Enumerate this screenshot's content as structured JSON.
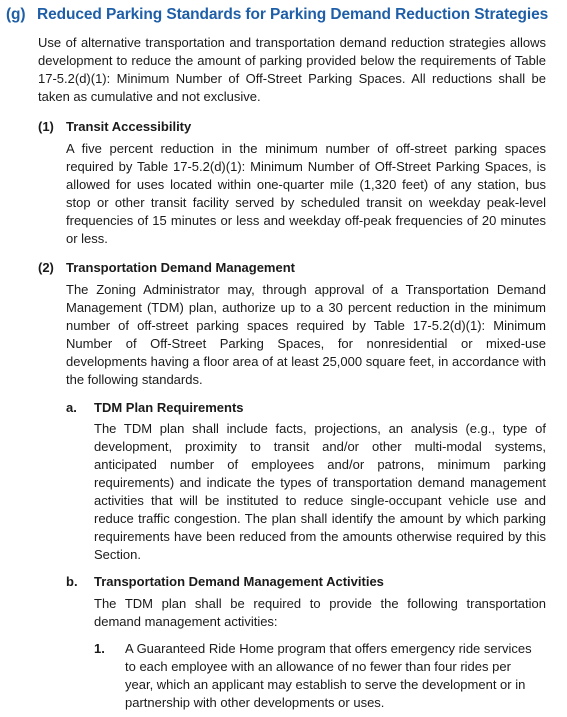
{
  "section": {
    "number": "(g)",
    "title": "Reduced Parking Standards for Parking Demand Reduction Strategies",
    "intro": "Use of alternative transportation and transportation demand reduction strategies allows development to reduce the amount of parking provided below the requirements of Table 17-5.2(d)(1): Minimum Number of Off-Street Parking Spaces. All reductions shall be taken as cumulative and not exclusive."
  },
  "subsections": [
    {
      "number": "(1)",
      "title": "Transit Accessibility",
      "body": "A five percent reduction in the minimum number of off-street parking spaces required by Table 17-5.2(d)(1): Minimum Number of Off-Street Parking Spaces, is allowed for uses located within one-quarter mile (1,320 feet) of any station, bus stop or other transit facility served by scheduled transit on weekday peak-level frequencies of 15 minutes or less and weekday off-peak frequencies of 20 minutes or less."
    },
    {
      "number": "(2)",
      "title": "Transportation Demand Management",
      "body": "The Zoning Administrator may, through approval of a Transportation Demand Management (TDM) plan, authorize up to a 30 percent reduction in the minimum number of off-street parking spaces required by Table 17-5.2(d)(1): Minimum Number of Off-Street Parking Spaces, for nonresidential or mixed-use developments having a floor area of at least 25,000 square feet, in accordance with the following standards."
    }
  ],
  "items": [
    {
      "number": "a.",
      "title": "TDM Plan Requirements",
      "body": "The TDM plan shall include facts, projections, an analysis (e.g., type of development, proximity to transit and/or other multi-modal systems, anticipated number of employees and/or patrons, minimum parking requirements) and indicate the types of transportation demand management activities that will be instituted to reduce single-occupant vehicle use and reduce traffic congestion. The plan shall identify the amount by which parking requirements have been reduced from the amounts otherwise required by this Section."
    },
    {
      "number": "b.",
      "title": "Transportation Demand Management Activities",
      "body": "The TDM plan shall be required to provide the following transportation demand management activities:"
    }
  ],
  "list": [
    {
      "number": "1.",
      "text": "A Guaranteed Ride Home program that offers emergency ride services to each employee with an allowance of no fewer than four rides per year, which an applicant may establish to serve the development or in partnership with other developments or uses."
    }
  ]
}
